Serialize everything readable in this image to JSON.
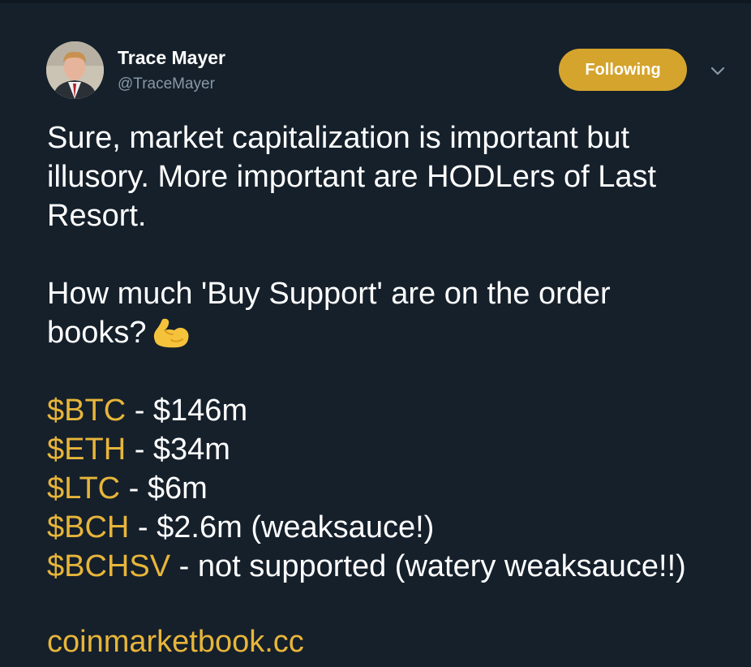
{
  "tweet": {
    "author": {
      "display_name": "Trace Mayer",
      "handle": "@TraceMayer"
    },
    "follow_button_label": "Following",
    "paragraph1": [
      "Sure, market capitalization is important but",
      "illusory. More important are HODLers of Last",
      "Resort."
    ],
    "paragraph2": [
      "How much 'Buy Support' are on the order",
      "books?"
    ],
    "emoji": "flexed-biceps",
    "support_list": [
      {
        "cashtag": "$BTC",
        "detail": " - $146m"
      },
      {
        "cashtag": "$ETH",
        "detail": " - $34m"
      },
      {
        "cashtag": "$LTC",
        "detail": " - $6m"
      },
      {
        "cashtag": "$BCH",
        "detail": " - $2.6m (weaksauce!)"
      },
      {
        "cashtag": "$BCHSV",
        "detail": " - not supported (watery weaksauce!!)"
      }
    ],
    "link_text": "coinmarketbook.cc"
  },
  "colors": {
    "background": "#15202b",
    "accent": "#e8b53a",
    "follow_button": "#d4a42c",
    "secondary_text": "#8899a6"
  }
}
